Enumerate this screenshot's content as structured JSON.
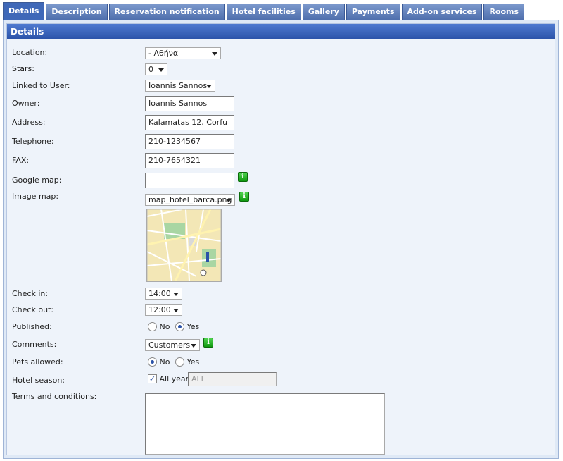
{
  "tabs": [
    "Details",
    "Description",
    "Reservation notification",
    "Hotel facilities",
    "Gallery",
    "Payments",
    "Add-on services",
    "Rooms"
  ],
  "section_title": "Details",
  "fields": {
    "location": {
      "label": "Location:",
      "value": " - Αθήνα"
    },
    "stars": {
      "label": "Stars:",
      "value": "0"
    },
    "linked_user": {
      "label": "Linked to User:",
      "value": "Ioannis Sannos"
    },
    "owner": {
      "label": "Owner:",
      "value": "Ioannis Sannos"
    },
    "address": {
      "label": "Address:",
      "value": "Kalamatas 12, Corfu"
    },
    "telephone": {
      "label": "Telephone:",
      "value": "210-1234567"
    },
    "fax": {
      "label": "FAX:",
      "value": "210-7654321"
    },
    "google_map": {
      "label": "Google map:",
      "value": ""
    },
    "image_map": {
      "label": "Image map:",
      "value": "map_hotel_barca.png"
    },
    "check_in": {
      "label": "Check in:",
      "value": "14:00"
    },
    "check_out": {
      "label": "Check out:",
      "value": "12:00"
    },
    "published": {
      "label": "Published:",
      "opt_no": "No",
      "opt_yes": "Yes",
      "selected": "yes"
    },
    "comments": {
      "label": "Comments:",
      "value": "Customers"
    },
    "pets": {
      "label": "Pets allowed:",
      "opt_no": "No",
      "opt_yes": "Yes",
      "selected": "no"
    },
    "season": {
      "label": "Hotel season:",
      "checkbox_label": "All year",
      "value": "ALL",
      "checked": true
    },
    "terms": {
      "label": "Terms and conditions:",
      "value": ""
    }
  },
  "info_glyph": "i",
  "colors": {
    "tab_bg": "#4f6fad",
    "header_bg": "#2a52a8",
    "panel_bg": "#eef3fa",
    "info_green": "#119a11"
  }
}
